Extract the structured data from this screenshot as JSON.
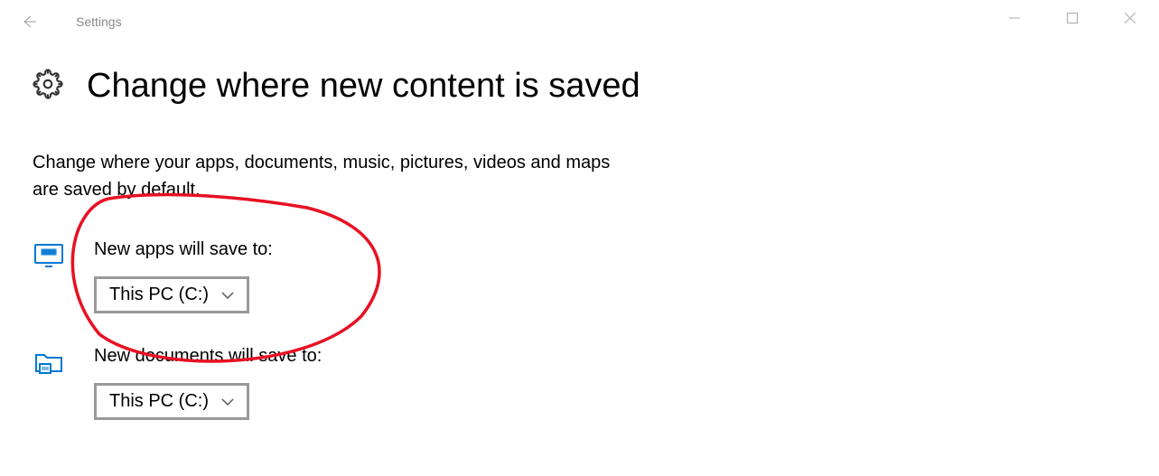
{
  "window": {
    "title": "Settings"
  },
  "page": {
    "title": "Change where new content is saved",
    "description": "Change where your apps, documents, music, pictures, videos and maps are saved by default."
  },
  "settings": {
    "apps": {
      "label": "New apps will save to:",
      "value": "This PC (C:)"
    },
    "documents": {
      "label": "New documents will save to:",
      "value": "This PC (C:)"
    }
  }
}
